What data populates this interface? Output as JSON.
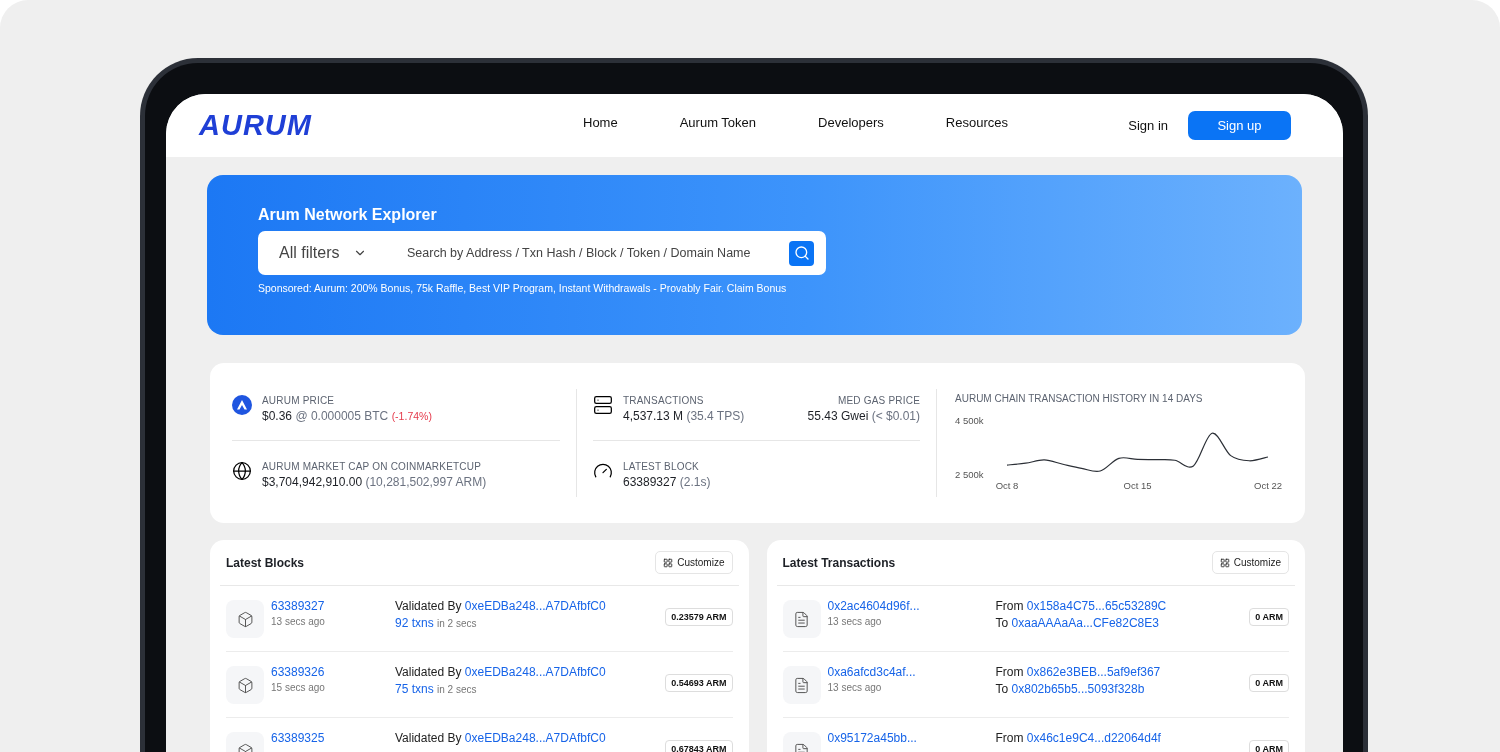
{
  "logo": "AURUM",
  "nav": {
    "links": [
      {
        "label": "Home"
      },
      {
        "label": "Aurum Token"
      },
      {
        "label": "Developers"
      },
      {
        "label": "Resources"
      }
    ],
    "sign_in": "Sign in",
    "sign_up": "Sign up"
  },
  "hero": {
    "title": "Arum Network Explorer",
    "filter": "All filters",
    "search": {
      "placeholder": "Search by Address / Txn Hash / Block / Token / Domain Name"
    },
    "sponsored": "Sponsored: Aurum: 200% Bonus, 75k Raffle, Best VIP Program, Instant Withdrawals - Provably Fair. Claim Bonus"
  },
  "stats": {
    "price": {
      "label": "AURUM PRICE",
      "value": "$0.36",
      "sub": "@ 0.000005 BTC",
      "change": "(-1.74%)"
    },
    "market_cap": {
      "label": "AURUM MARKET CAP ON COINMARKETCUP",
      "value": "$3,704,942,910.00",
      "sub": "(10,281,502,997 ARM)"
    },
    "transactions": {
      "label": "TRANSACTIONS",
      "value": "4,537.13 M",
      "sub": "(35.4 TPS)"
    },
    "gas": {
      "label": "MED GAS PRICE",
      "value": "55.43 Gwei",
      "sub": "(< $0.01)"
    },
    "latest_block": {
      "label": "LATEST BLOCK",
      "value": "63389327",
      "sub": "(2.1s)"
    },
    "chart_data": {
      "type": "line",
      "title": "AURUM CHAIN TRANSACTION  HISTORY IN 14 DAYS",
      "categories": [
        "Oct 8",
        null,
        null,
        null,
        null,
        null,
        null,
        "Oct 15",
        null,
        null,
        null,
        null,
        null,
        null,
        "Oct 22"
      ],
      "series": [
        {
          "color": "#2b2f36",
          "values": [
            2830,
            2900,
            3020,
            2860,
            2710,
            2610,
            3080,
            3040,
            3030,
            3010,
            2800,
            4010,
            3180,
            2990,
            3130
          ]
        }
      ],
      "ylim": [
        2500,
        4500
      ],
      "yticks": [
        {
          "value": 4500,
          "label": "4 500k"
        },
        {
          "value": 2500,
          "label": "2 500k"
        }
      ]
    }
  },
  "blocks": {
    "title": "Latest Blocks",
    "customize": "Customize",
    "rows": [
      {
        "number": "63389327",
        "age": "13 secs ago",
        "validated_by": "Validated By",
        "validator": "0xeEDBa248...A7DAfbfC0",
        "txns": "92 txns",
        "txns_time": "in 2 secs",
        "reward": "0.23579 ARM"
      },
      {
        "number": "63389326",
        "age": "15 secs ago",
        "validated_by": "Validated By",
        "validator": "0xeEDBa248...A7DAfbfC0",
        "txns": "75 txns",
        "txns_time": "in 2 secs",
        "reward": "0.54693 ARM"
      },
      {
        "number": "63389325",
        "validated_by": "Validated By",
        "validator": "0xeEDBa248...A7DAfbfC0",
        "reward": "0.67843 ARM"
      }
    ]
  },
  "transactions": {
    "title": "Latest Transactions",
    "customize": "Customize",
    "rows": [
      {
        "hash": "0x2ac4604d96f...",
        "age": "13 secs ago",
        "from_label": "From",
        "from": "0x158a4C75...65c53289C",
        "to_label": "To",
        "to": "0xaaAAAaAa...CFe82C8E3",
        "amount": "0 ARM"
      },
      {
        "hash": "0xa6afcd3c4af...",
        "age": "13 secs ago",
        "from_label": "From",
        "from": "0x862e3BEB...5af9ef367",
        "to_label": "To",
        "to": "0x802b65b5...5093f328b",
        "amount": "0 ARM"
      },
      {
        "hash": "0x95172a45bb...",
        "from_label": "From",
        "from": "0x46c1e9C4...d22064d4f",
        "amount": "0 ARM"
      }
    ]
  }
}
